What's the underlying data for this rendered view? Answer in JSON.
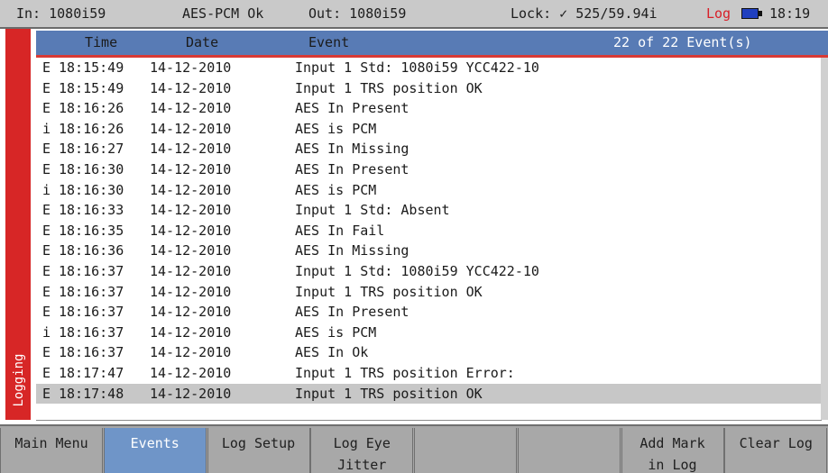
{
  "status": {
    "input": "In: 1080i59",
    "audio": "AES-PCM Ok",
    "output": "Out: 1080i59",
    "lock": "Lock: ✓ 525/59.94i",
    "log": "Log",
    "time": "18:19",
    "battery_icon": "battery-icon"
  },
  "sidebar": {
    "label": "Logging"
  },
  "table": {
    "headers": {
      "time": "Time",
      "date": "Date",
      "event": "Event"
    },
    "count": "22  of 22 Event(s)",
    "rows": [
      {
        "type": "E",
        "time": "18:15:49",
        "date": "14-12-2010",
        "event": "Input 1 Std: 1080i59 YCC422-10"
      },
      {
        "type": "E",
        "time": "18:15:49",
        "date": "14-12-2010",
        "event": "Input 1 TRS position OK"
      },
      {
        "type": "E",
        "time": "18:16:26",
        "date": "14-12-2010",
        "event": "AES In Present"
      },
      {
        "type": "i",
        "time": "18:16:26",
        "date": "14-12-2010",
        "event": "AES is PCM"
      },
      {
        "type": "E",
        "time": "18:16:27",
        "date": "14-12-2010",
        "event": "AES In Missing"
      },
      {
        "type": "E",
        "time": "18:16:30",
        "date": "14-12-2010",
        "event": "AES In Present"
      },
      {
        "type": "i",
        "time": "18:16:30",
        "date": "14-12-2010",
        "event": "AES is PCM"
      },
      {
        "type": "E",
        "time": "18:16:33",
        "date": "14-12-2010",
        "event": "Input 1 Std: Absent"
      },
      {
        "type": "E",
        "time": "18:16:35",
        "date": "14-12-2010",
        "event": "AES In Fail"
      },
      {
        "type": "E",
        "time": "18:16:36",
        "date": "14-12-2010",
        "event": "AES In Missing"
      },
      {
        "type": "E",
        "time": "18:16:37",
        "date": "14-12-2010",
        "event": "Input 1 Std: 1080i59 YCC422-10"
      },
      {
        "type": "E",
        "time": "18:16:37",
        "date": "14-12-2010",
        "event": "Input 1 TRS position OK"
      },
      {
        "type": "E",
        "time": "18:16:37",
        "date": "14-12-2010",
        "event": "AES In Present"
      },
      {
        "type": "i",
        "time": "18:16:37",
        "date": "14-12-2010",
        "event": "AES is PCM"
      },
      {
        "type": "E",
        "time": "18:16:37",
        "date": "14-12-2010",
        "event": "AES In Ok"
      },
      {
        "type": "E",
        "time": "18:17:47",
        "date": "14-12-2010",
        "event": "Input 1 TRS position Error:"
      },
      {
        "type": "E",
        "time": "18:17:48",
        "date": "14-12-2010",
        "event": "Input 1 TRS position OK",
        "selected": true
      }
    ]
  },
  "softkeys": [
    {
      "line1": "Main Menu",
      "line2": ""
    },
    {
      "line1": "Events",
      "line2": "",
      "active": true
    },
    {
      "line1": "Log Setup",
      "line2": ""
    },
    {
      "line1": "Log Eye",
      "line2": "Jitter"
    },
    {
      "line1": "",
      "line2": ""
    },
    {
      "line1": "",
      "line2": ""
    },
    {
      "line1": "Add Mark",
      "line2": "in Log"
    },
    {
      "line1": "Clear Log",
      "line2": ""
    }
  ],
  "colors": {
    "header_bg": "#587bb5",
    "sidebar_bg": "#d72626",
    "active_key_bg": "#6f95c8",
    "selected_row_bg": "#c7c7c7",
    "log_word": "#d81f28"
  }
}
